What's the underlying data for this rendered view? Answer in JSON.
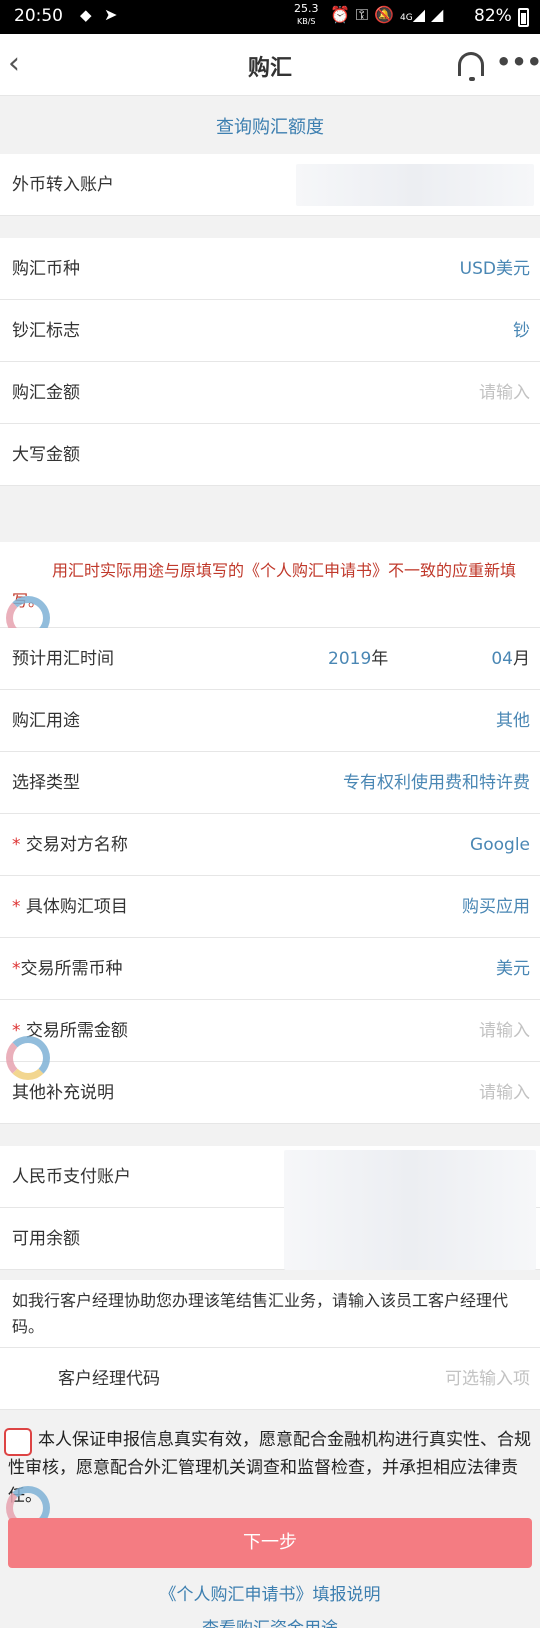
{
  "status_bar": {
    "time": "20:50",
    "net_speed_value": "25.3",
    "net_speed_unit": "KB/S",
    "network": "4G",
    "battery": "82%"
  },
  "header": {
    "back_icon": "chevron-left-icon",
    "title": "购汇",
    "support_icon": "headset-icon",
    "more_icon": "more-icon",
    "more_glyph": "•••"
  },
  "query_link": "查询购汇额度",
  "account_in": {
    "label": "外币转入账户"
  },
  "currency": {
    "label": "购汇币种",
    "value": "USD美元"
  },
  "cash_flag": {
    "label": "钞汇标志",
    "value": "钞"
  },
  "amount": {
    "label": "购汇金额",
    "placeholder": "请输入"
  },
  "amount_words": {
    "label": "大写金额"
  },
  "notice": "用汇时实际用途与原填写的《个人购汇申请书》不一致的应重新填写。",
  "use_time": {
    "label": "预计用汇时间",
    "year_value": "2019",
    "year_unit": "年",
    "month_value": "04",
    "month_unit": "月"
  },
  "purpose": {
    "label": "购汇用途",
    "value": "其他"
  },
  "type": {
    "label": "选择类型",
    "value": "专有权利使用费和特许费"
  },
  "counterparty": {
    "star": "* ",
    "label": "交易对方名称",
    "value": "Google"
  },
  "item": {
    "star": "* ",
    "label": "具体购汇项目",
    "value": "购买应用"
  },
  "trade_currency": {
    "star": "*",
    "label": "交易所需币种",
    "value": "美元"
  },
  "trade_amount": {
    "star": "* ",
    "label": "交易所需金额",
    "placeholder": "请输入"
  },
  "remarks": {
    "label": "其他补充说明",
    "placeholder": "请输入"
  },
  "rmb_account": {
    "label": "人民币支付账户"
  },
  "balance": {
    "label": "可用余额"
  },
  "manager_tip": "如我行客户经理协助您办理该笔结售汇业务，请输入该员工客户经理代码。",
  "manager_code": {
    "label": "客户经理代码",
    "placeholder": "可选输入项"
  },
  "agreement": "本人保证申报信息真实有效，愿意配合金融机构进行真实性、合规性审核，愿意配合外汇管理机关调查和监督检查，并承担相应法律责任。",
  "next_button": "下一步",
  "link_form": "《个人购汇申请书》填报说明",
  "link_purpose": "查看购汇资金用途",
  "colors": {
    "accent_blue": "#4a87b4",
    "notice_red": "#c0392b",
    "button_pink": "#f47c82",
    "placeholder_gray": "#c2c2c2"
  }
}
